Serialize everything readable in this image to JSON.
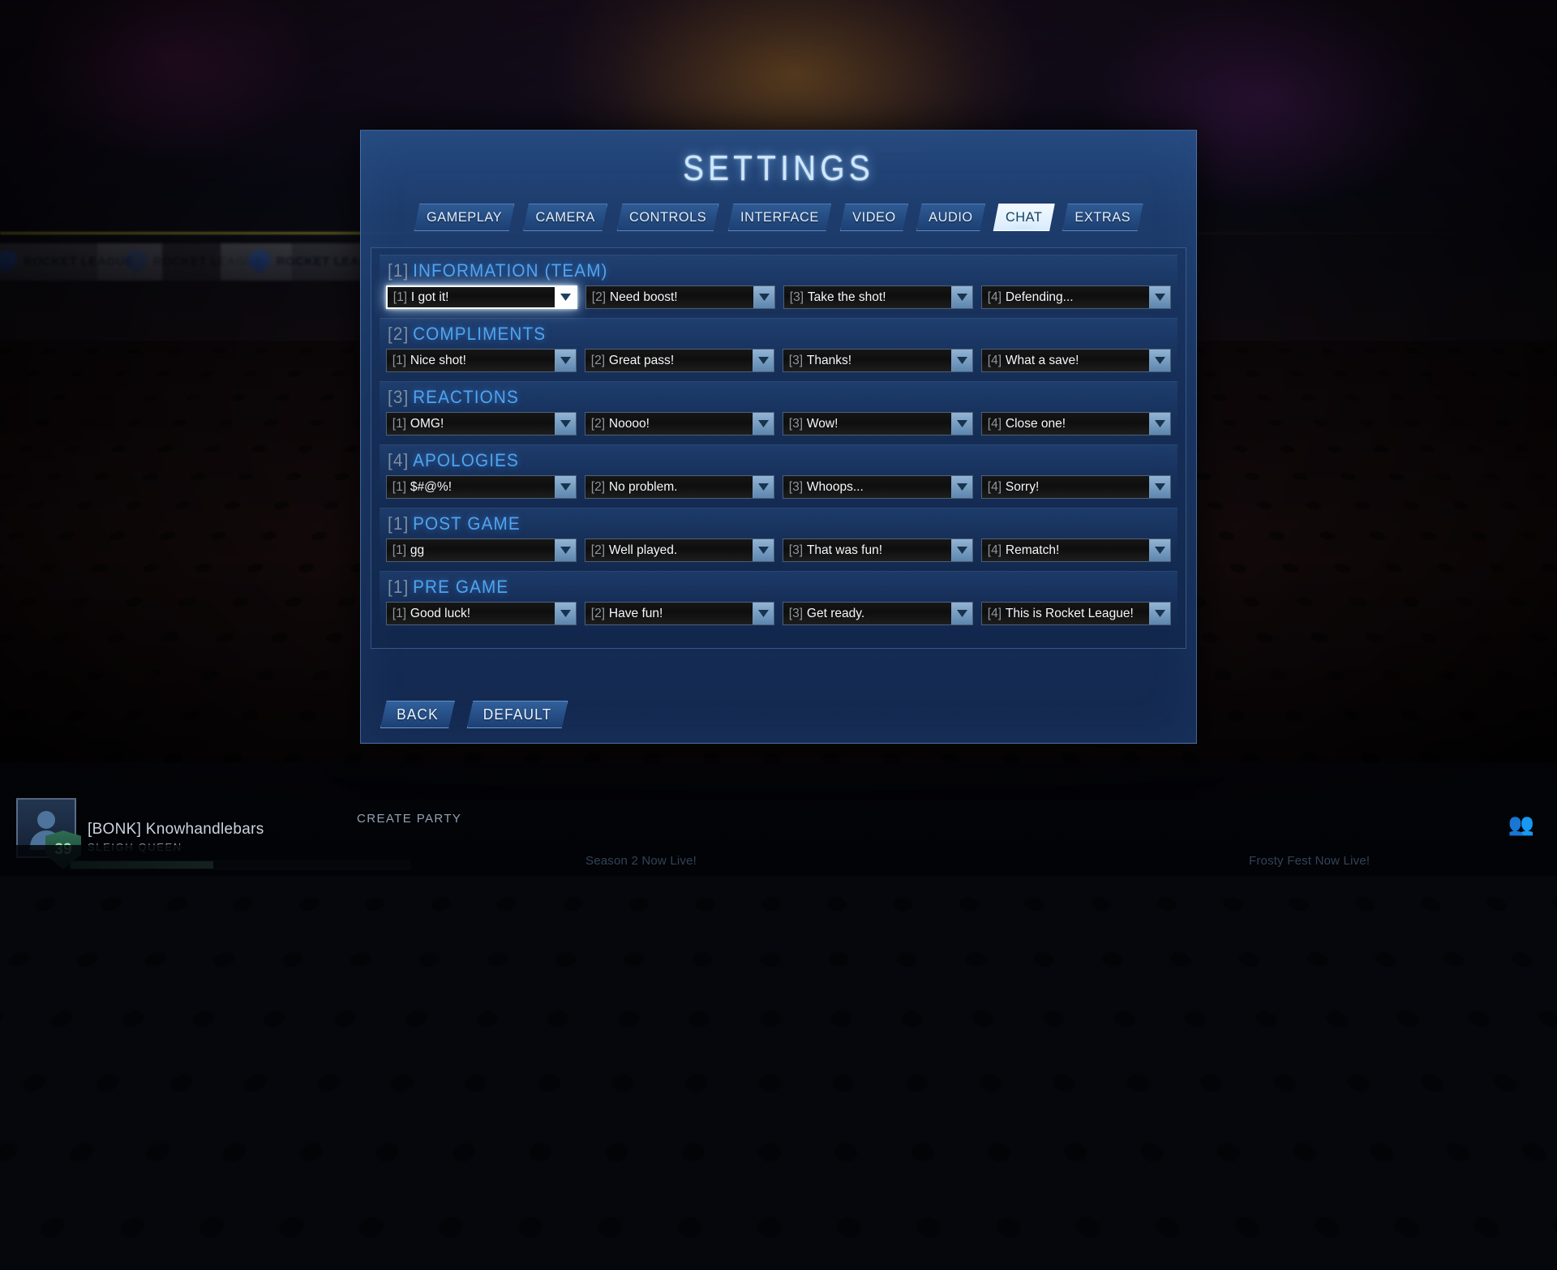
{
  "background": {
    "banners": [
      "ROCKET LEAGUE",
      "ROCKET LEAGUE",
      "ROCKET LEAGUE"
    ]
  },
  "modal": {
    "title": "SETTINGS",
    "tabs": [
      {
        "label": "GAMEPLAY",
        "active": false
      },
      {
        "label": "CAMERA",
        "active": false
      },
      {
        "label": "CONTROLS",
        "active": false
      },
      {
        "label": "INTERFACE",
        "active": false
      },
      {
        "label": "VIDEO",
        "active": false
      },
      {
        "label": "AUDIO",
        "active": false
      },
      {
        "label": "CHAT",
        "active": true
      },
      {
        "label": "EXTRAS",
        "active": false
      }
    ],
    "sections": [
      {
        "index": "[1]",
        "name": "INFORMATION (TEAM)",
        "items": [
          {
            "key": "[1]",
            "value": "I got it!",
            "focused": true
          },
          {
            "key": "[2]",
            "value": "Need boost!",
            "focused": false
          },
          {
            "key": "[3]",
            "value": "Take the shot!",
            "focused": false
          },
          {
            "key": "[4]",
            "value": "Defending...",
            "focused": false
          }
        ]
      },
      {
        "index": "[2]",
        "name": "COMPLIMENTS",
        "items": [
          {
            "key": "[1]",
            "value": "Nice shot!",
            "focused": false
          },
          {
            "key": "[2]",
            "value": "Great pass!",
            "focused": false
          },
          {
            "key": "[3]",
            "value": "Thanks!",
            "focused": false
          },
          {
            "key": "[4]",
            "value": "What a save!",
            "focused": false
          }
        ]
      },
      {
        "index": "[3]",
        "name": "REACTIONS",
        "items": [
          {
            "key": "[1]",
            "value": "OMG!",
            "focused": false
          },
          {
            "key": "[2]",
            "value": "Noooo!",
            "focused": false
          },
          {
            "key": "[3]",
            "value": "Wow!",
            "focused": false
          },
          {
            "key": "[4]",
            "value": "Close one!",
            "focused": false
          }
        ]
      },
      {
        "index": "[4]",
        "name": "APOLOGIES",
        "items": [
          {
            "key": "[1]",
            "value": "$#@%!",
            "focused": false
          },
          {
            "key": "[2]",
            "value": "No problem.",
            "focused": false
          },
          {
            "key": "[3]",
            "value": "Whoops...",
            "focused": false
          },
          {
            "key": "[4]",
            "value": "Sorry!",
            "focused": false
          }
        ]
      },
      {
        "index": "[1]",
        "name": "POST GAME",
        "items": [
          {
            "key": "[1]",
            "value": "gg",
            "focused": false
          },
          {
            "key": "[2]",
            "value": "Well played.",
            "focused": false
          },
          {
            "key": "[3]",
            "value": "That was fun!",
            "focused": false
          },
          {
            "key": "[4]",
            "value": "Rematch!",
            "focused": false
          }
        ]
      },
      {
        "index": "[1]",
        "name": "PRE GAME",
        "items": [
          {
            "key": "[1]",
            "value": "Good luck!",
            "focused": false
          },
          {
            "key": "[2]",
            "value": "Have fun!",
            "focused": false
          },
          {
            "key": "[3]",
            "value": "Get ready.",
            "focused": false
          },
          {
            "key": "[4]",
            "value": "This is Rocket League!",
            "focused": false
          }
        ]
      }
    ],
    "buttons": [
      {
        "label": "BACK"
      },
      {
        "label": "DEFAULT"
      }
    ]
  },
  "hud": {
    "player_name": "[BONK] Knowhandlebars",
    "player_title": "SLEIGH QUEEN",
    "level": "39",
    "create_party": "CREATE PARTY",
    "news_left": "Season 2 Now Live!",
    "news_right": "Frosty Fest Now Live!"
  }
}
